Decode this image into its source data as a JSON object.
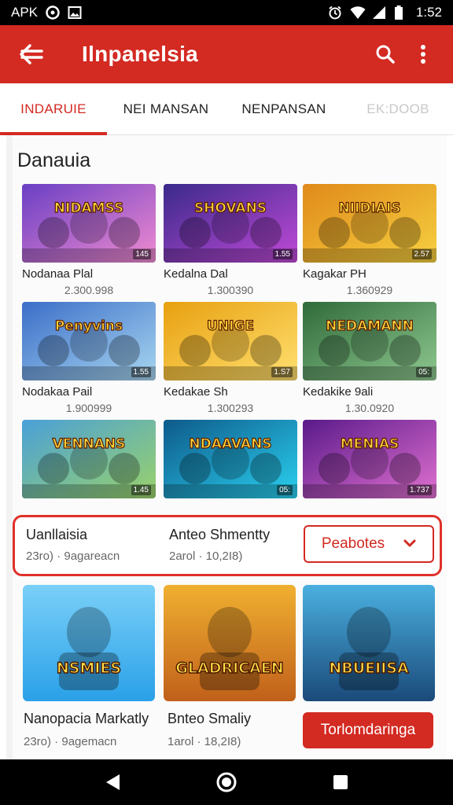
{
  "status_bar": {
    "carrier": "APK",
    "time": "1:52",
    "icons": [
      "at-sign-icon",
      "image-icon",
      "alarm-icon",
      "wifi-icon",
      "signal-icon",
      "battery-icon"
    ]
  },
  "app_bar": {
    "title": "Ilnpanelsia",
    "colors": {
      "primary": "#d32a22"
    },
    "icons": [
      "back-arrow-icon",
      "search-icon",
      "more-vert-icon"
    ]
  },
  "tabs": [
    {
      "label": "INDARUIE",
      "state": "active"
    },
    {
      "label": "NEI MANSAN",
      "state": "normal"
    },
    {
      "label": "NENPANSAN",
      "state": "normal"
    },
    {
      "label": "EK:DOOB",
      "state": "faded"
    }
  ],
  "section": {
    "title": "Danauia"
  },
  "games": [
    {
      "name": "Nodanaa Plal",
      "count": "2.300.998",
      "art": "NIDAMSS",
      "palette": [
        "#6a3fc4",
        "#f08bd0"
      ]
    },
    {
      "name": "Kedalna Dal",
      "count": "1.300390",
      "art": "SHOVANS",
      "palette": [
        "#3a2a8a",
        "#c04ad8"
      ]
    },
    {
      "name": "Kagakar PH",
      "count": "1.360929",
      "art": "NIIDIAIS",
      "palette": [
        "#e08a1a",
        "#f6d040"
      ]
    },
    {
      "name": "Nodakaa Pail",
      "count": "1.900999",
      "art": "Penyvins",
      "palette": [
        "#3b6ec8",
        "#a8d6f0"
      ]
    },
    {
      "name": "Kedakae Sh",
      "count": "1.300293",
      "art": "UNIGE",
      "palette": [
        "#e8a010",
        "#ffe070"
      ]
    },
    {
      "name": "Kedakike 9ali",
      "count": "1.30.0920",
      "art": "NEDAMANN",
      "palette": [
        "#2f6a3a",
        "#8fc890"
      ]
    },
    {
      "name": "",
      "count": "",
      "art": "VENNANS",
      "palette": [
        "#4aa0d8",
        "#9ad26a"
      ]
    },
    {
      "name": "",
      "count": "",
      "art": "NDAAVANS",
      "palette": [
        "#0e5a8a",
        "#2ad0f0"
      ]
    },
    {
      "name": "",
      "count": "",
      "art": "MENIAS",
      "palette": [
        "#5a1a8a",
        "#e070d0"
      ]
    }
  ],
  "badges": [
    "145",
    "1.55",
    "2.57",
    "1.55",
    "1.S7",
    "05:",
    "1.45",
    "05:",
    "1.737"
  ],
  "highlight_row": {
    "items": [
      {
        "title": "Uanllaisia",
        "subtitle": "23ro) · 9agareacn"
      },
      {
        "title": "Anteo Shmentty",
        "subtitle": "2arol · 10,2I8)"
      }
    ],
    "dropdown": {
      "label": "Peabotes"
    }
  },
  "featured": [
    {
      "art": "NSMIES",
      "palette": [
        "#2aa0e8",
        "#7ad0f8"
      ]
    },
    {
      "art": "GLADRICAEN",
      "palette": [
        "#c0601a",
        "#f0b030"
      ]
    },
    {
      "art": "NBUEIISA",
      "palette": [
        "#1a4a7a",
        "#4ab0e0"
      ]
    }
  ],
  "bottom_row": {
    "items": [
      {
        "title": "Nanopacia Markatly",
        "subtitle": "23ro) · 9agemacn"
      },
      {
        "title": "Bnteo Smaliy",
        "subtitle": "1arol · 18,2I8)"
      }
    ],
    "cta": {
      "label": "Torlomdaringa"
    }
  },
  "nav_bar": {
    "icons": [
      "back-triangle-icon",
      "home-circle-icon",
      "recents-square-icon"
    ]
  }
}
